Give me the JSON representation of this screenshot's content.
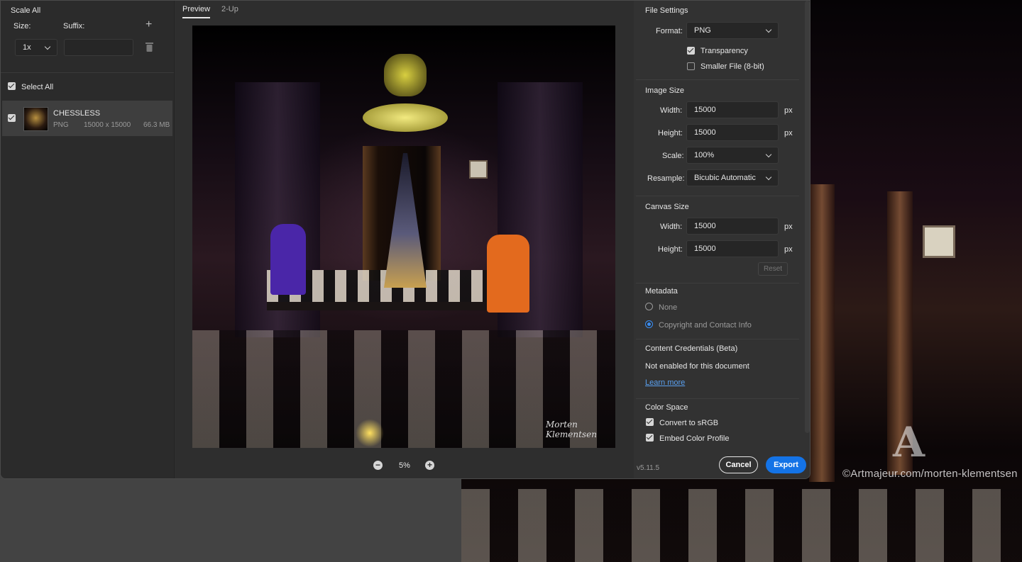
{
  "left_panel": {
    "scale_all": "Scale All",
    "size_label": "Size:",
    "suffix_label": "Suffix:",
    "size_value": "1x",
    "suffix_value": "",
    "select_all": "Select All",
    "file": {
      "name": "CHESSLESS",
      "format": "PNG",
      "dimensions": "15000 x 15000",
      "size": "66.3 MB"
    }
  },
  "center": {
    "tabs": [
      "Preview",
      "2-Up"
    ],
    "active_tab": "Preview",
    "zoom": "5%",
    "signature": "Morten Klementsen"
  },
  "right_panel": {
    "file_settings": {
      "heading": "File Settings",
      "format_label": "Format:",
      "format_value": "PNG",
      "transparency": "Transparency",
      "transparency_checked": true,
      "smaller_file": "Smaller File (8-bit)",
      "smaller_file_checked": false
    },
    "image_size": {
      "heading": "Image Size",
      "width_label": "Width:",
      "width_value": "15000",
      "height_label": "Height:",
      "height_value": "15000",
      "unit": "px",
      "scale_label": "Scale:",
      "scale_value": "100%",
      "resample_label": "Resample:",
      "resample_value": "Bicubic Automatic"
    },
    "canvas_size": {
      "heading": "Canvas Size",
      "width_label": "Width:",
      "width_value": "15000",
      "height_label": "Height:",
      "height_value": "15000",
      "unit": "px",
      "reset": "Reset"
    },
    "metadata": {
      "heading": "Metadata",
      "option_none": "None",
      "option_copyright": "Copyright and Contact Info",
      "selected": "Copyright and Contact Info"
    },
    "content_credentials": {
      "heading": "Content Credentials (Beta)",
      "status": "Not enabled for this document",
      "learn_more": "Learn more"
    },
    "color_space": {
      "heading": "Color Space",
      "convert_srgb": "Convert to sRGB",
      "embed_profile": "Embed Color Profile",
      "convert_checked": true,
      "embed_checked": true
    }
  },
  "footer": {
    "version": "v5.11.5",
    "cancel": "Cancel",
    "export": "Export"
  },
  "background": {
    "watermark": "©Artmajeur.com/morten-klementsen"
  },
  "colors": {
    "accent": "#1473e6",
    "dialog_bg": "#323232"
  }
}
